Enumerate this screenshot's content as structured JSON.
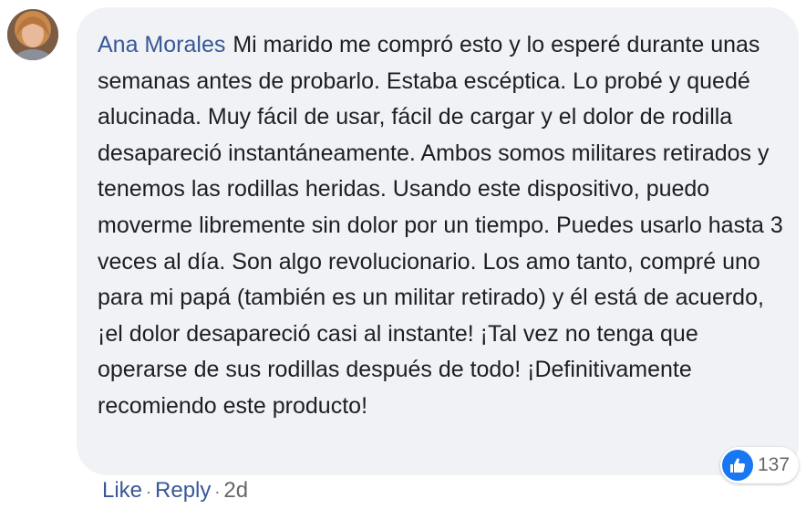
{
  "comment": {
    "author": "Ana Morales",
    "text": "Mi marido me compró esto y lo esperé durante unas semanas antes de probarlo. Estaba escéptica. Lo probé y quedé alucinada. Muy fácil de usar, fácil de cargar y el dolor de rodilla desapareció instantáneamente. Ambos somos militares retirados y tenemos las rodillas heridas. Usando este dispositivo, puedo moverme libremente sin dolor por un tiempo. Puedes usarlo hasta 3 veces al día. Son algo revolucionario. Los amo tanto, compré uno para mi papá (también es un militar retirado) y él está de acuerdo, ¡el dolor desapareció casi al instante! ¡Tal vez no tenga que operarse de sus rodillas después de todo! ¡Definitivamente recomiendo este producto!",
    "reactions": {
      "icon": "thumbs-up-icon",
      "count": "137",
      "color": "#1877f2"
    },
    "actions": {
      "like_label": "Like",
      "reply_label": "Reply",
      "separator": "·",
      "timestamp": "2d"
    }
  },
  "colors": {
    "bubble": "#f0f2f5",
    "author_link": "#385898",
    "body_text": "#1c1e21",
    "meta_text": "#65676b"
  }
}
